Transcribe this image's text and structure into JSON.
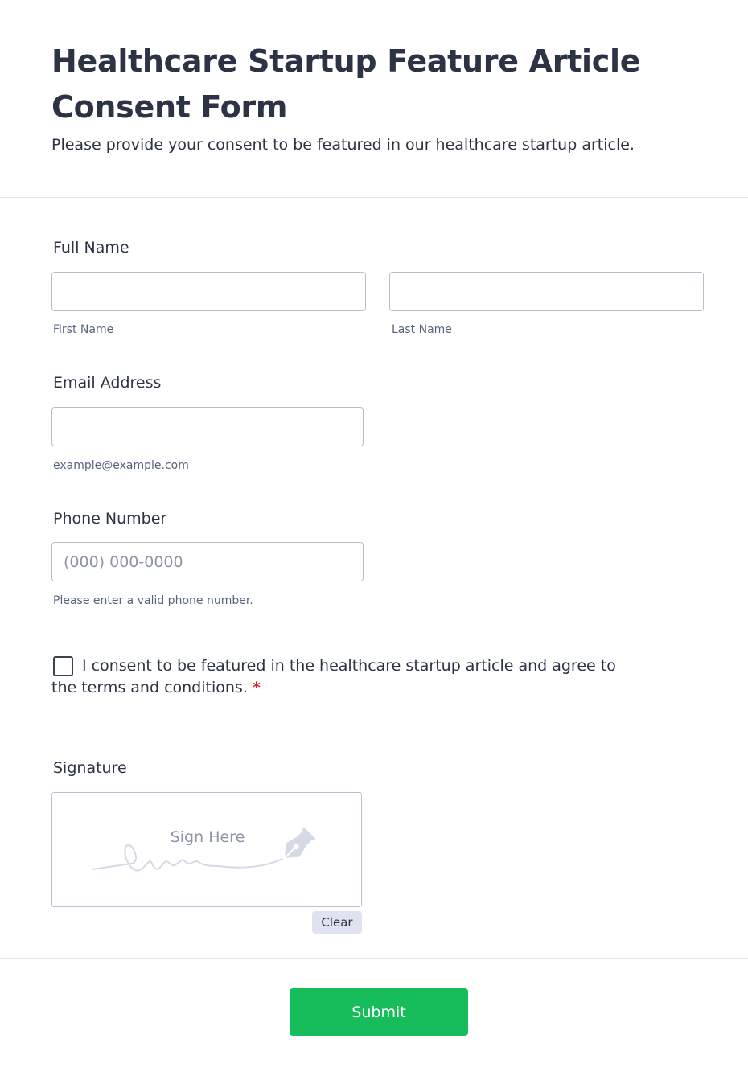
{
  "form": {
    "title": "Healthcare Startup Feature Article Consent Form",
    "subtitle": "Please provide your consent to be featured in our healthcare startup article."
  },
  "full_name": {
    "label": "Full Name",
    "first_name_value": "",
    "first_name_sublabel": "First Name",
    "last_name_value": "",
    "last_name_sublabel": "Last Name"
  },
  "email": {
    "label": "Email Address",
    "value": "",
    "sublabel": "example@example.com"
  },
  "phone": {
    "label": "Phone Number",
    "value": "",
    "placeholder": "(000) 000-0000",
    "sublabel": "Please enter a valid phone number."
  },
  "consent": {
    "text": "I consent to be featured in the healthcare startup article and agree to the terms and conditions.",
    "required_mark": "*",
    "checked": false
  },
  "signature": {
    "label": "Signature",
    "placeholder_text": "Sign Here",
    "icon": "pen-nib-icon",
    "clear_label": "Clear"
  },
  "submit": {
    "label": "Submit",
    "color": "#18bd5b"
  }
}
